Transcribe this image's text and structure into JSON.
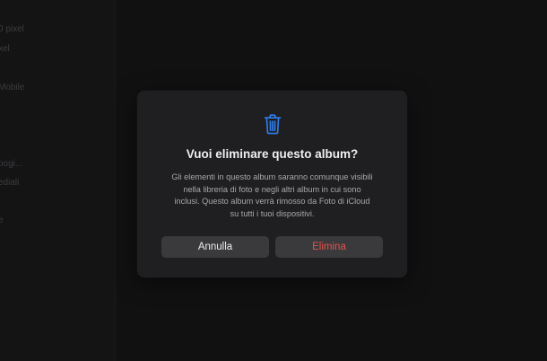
{
  "sidebar": {
    "items": [
      {
        "label": "0 pixel"
      },
      {
        "label": "xel"
      },
      {
        "label": "Mobile"
      },
      {
        "label": "oogi..."
      },
      {
        "label": "ediali"
      },
      {
        "label": "e"
      }
    ]
  },
  "dialog": {
    "icon": "trash-icon",
    "title": "Vuoi eliminare questo album?",
    "message": "Gli elementi in questo album saranno comunque visibili nella libreria di foto e negli altri album in cui sono inclusi. Questo album verrà rimosso da Foto di iCloud su tutti i tuoi dispositivi.",
    "cancel_label": "Annulla",
    "delete_label": "Elimina"
  },
  "colors": {
    "accent": "#2f7ff2",
    "destructive": "#e5514b",
    "dialog_bg": "#1f1f21",
    "button_bg": "#3a3a3c"
  }
}
